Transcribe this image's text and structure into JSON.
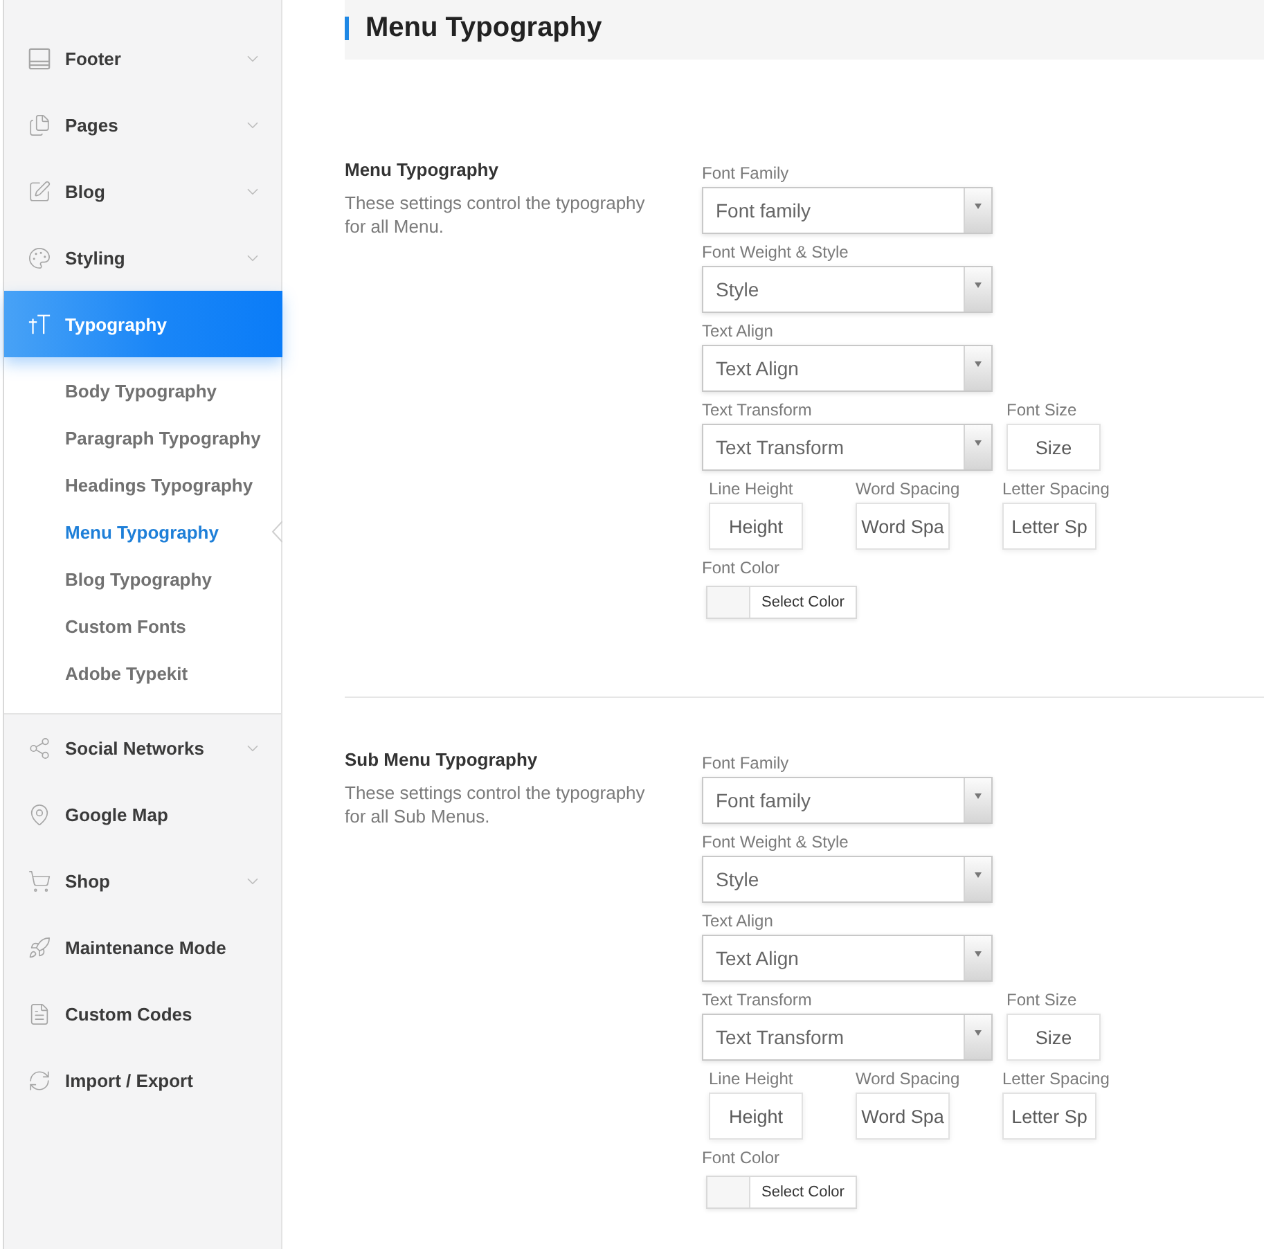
{
  "sidebar": {
    "items": [
      {
        "label": "Footer",
        "chevron": true,
        "selected": false
      },
      {
        "label": "Pages",
        "chevron": true,
        "selected": false
      },
      {
        "label": "Blog",
        "chevron": true,
        "selected": false
      },
      {
        "label": "Styling",
        "chevron": true,
        "selected": false
      },
      {
        "label": "Typography",
        "chevron": false,
        "selected": true,
        "children": [
          {
            "label": "Body Typography",
            "selected": false
          },
          {
            "label": "Paragraph Typography",
            "selected": false
          },
          {
            "label": "Headings Typography",
            "selected": false
          },
          {
            "label": "Menu Typography",
            "selected": true
          },
          {
            "label": "Blog Typography",
            "selected": false
          },
          {
            "label": "Custom Fonts",
            "selected": false
          },
          {
            "label": "Adobe Typekit",
            "selected": false
          }
        ]
      },
      {
        "label": "Social Networks",
        "chevron": true,
        "selected": false
      },
      {
        "label": "Google Map",
        "chevron": false,
        "selected": false
      },
      {
        "label": "Shop",
        "chevron": true,
        "selected": false
      },
      {
        "label": "Maintenance Mode",
        "chevron": false,
        "selected": false
      },
      {
        "label": "Custom Codes",
        "chevron": false,
        "selected": false
      },
      {
        "label": "Import / Export",
        "chevron": false,
        "selected": false
      }
    ]
  },
  "header": {
    "title": "Menu Typography"
  },
  "sections": [
    {
      "title": "Menu Typography",
      "description": "These settings control the typography for all Menu.",
      "rows": [
        {
          "fields": [
            {
              "kind": "select",
              "label": "Font Family",
              "value": "Font family"
            }
          ]
        },
        {
          "fields": [
            {
              "kind": "select",
              "label": "Font Weight & Style",
              "value": "Style"
            }
          ]
        },
        {
          "fields": [
            {
              "kind": "select",
              "label": "Text Align",
              "value": "Text Align"
            }
          ]
        },
        {
          "fields": [
            {
              "kind": "select",
              "label": "Text Transform",
              "value": "Text Transform"
            },
            {
              "kind": "input",
              "label": "Font Size",
              "placeholder": "Size"
            }
          ]
        },
        {
          "fields": [
            {
              "kind": "input",
              "label": "Line Height",
              "placeholder": "Height"
            },
            {
              "kind": "input",
              "label": "Word Spacing",
              "placeholder": "Word Spa"
            },
            {
              "kind": "input",
              "label": "Letter Spacing",
              "placeholder": "Letter Sp"
            }
          ]
        },
        {
          "fields": [
            {
              "kind": "color",
              "label": "Font Color",
              "button": "Select Color"
            }
          ]
        }
      ]
    },
    {
      "title": "Sub Menu Typography",
      "description": "These settings control the typography for all Sub Menus.",
      "rows": [
        {
          "fields": [
            {
              "kind": "select",
              "label": "Font Family",
              "value": "Font family"
            }
          ]
        },
        {
          "fields": [
            {
              "kind": "select",
              "label": "Font Weight & Style",
              "value": "Style"
            }
          ]
        },
        {
          "fields": [
            {
              "kind": "select",
              "label": "Text Align",
              "value": "Text Align"
            }
          ]
        },
        {
          "fields": [
            {
              "kind": "select",
              "label": "Text Transform",
              "value": "Text Transform"
            },
            {
              "kind": "input",
              "label": "Font Size",
              "placeholder": "Size"
            }
          ]
        },
        {
          "fields": [
            {
              "kind": "input",
              "label": "Line Height",
              "placeholder": "Height"
            },
            {
              "kind": "input",
              "label": "Word Spacing",
              "placeholder": "Word Spa"
            },
            {
              "kind": "input",
              "label": "Letter Spacing",
              "placeholder": "Letter Sp"
            }
          ]
        },
        {
          "fields": [
            {
              "kind": "color",
              "label": "Font Color",
              "button": "Select Color"
            }
          ]
        }
      ]
    }
  ]
}
